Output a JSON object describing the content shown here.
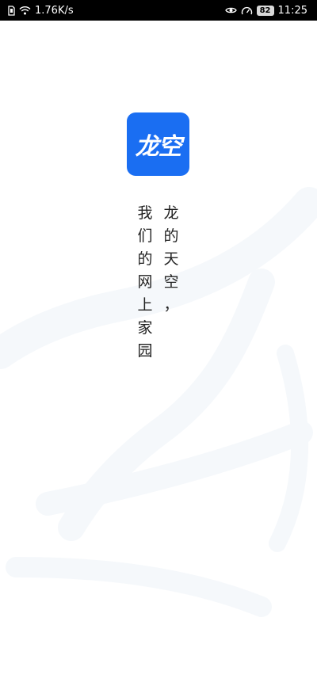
{
  "status_bar": {
    "network_speed": "1.76K/s",
    "battery_level": "82",
    "time": "11:25",
    "icons": [
      "sim-icon",
      "wifi-icon",
      "eye-icon",
      "speedometer-icon",
      "battery-icon"
    ]
  },
  "app": {
    "logo_text": "龙空",
    "logo_color": "#1a6ef2"
  },
  "slogan": {
    "line1": [
      "龙",
      "的",
      "天",
      "空",
      "，"
    ],
    "line2": [
      "我",
      "们",
      "的",
      "网",
      "上",
      "家",
      "园"
    ]
  }
}
